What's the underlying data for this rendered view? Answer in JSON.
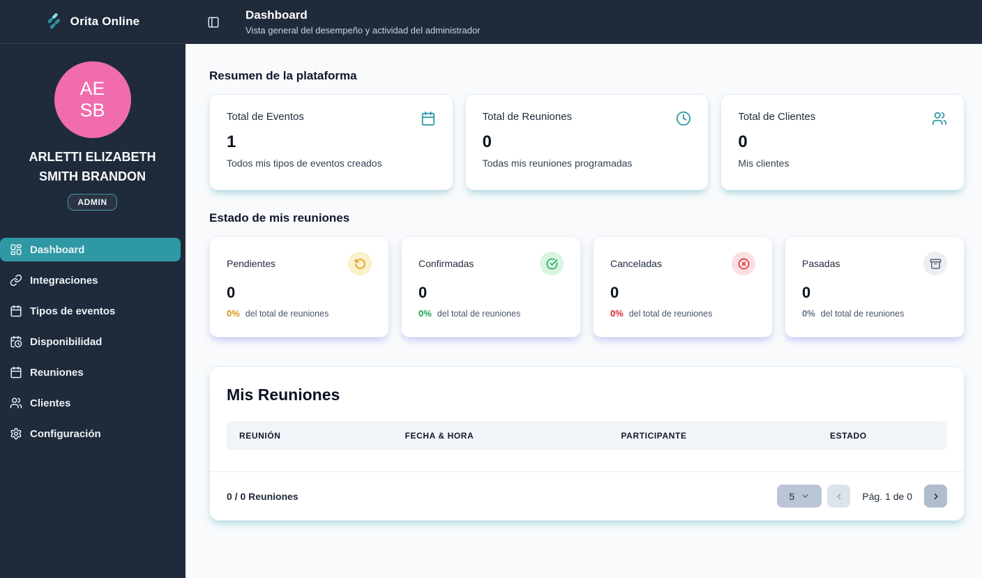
{
  "brand": {
    "name": "Orita Online"
  },
  "user": {
    "initials_line1": "AE",
    "initials_line2": "SB",
    "name_line1": "ARLETTI ELIZABETH",
    "name_line2": "SMITH BRANDON",
    "role": "ADMIN"
  },
  "sidebar": {
    "nav": [
      {
        "label": "Dashboard",
        "icon": "layout-dashboard-icon",
        "active": true
      },
      {
        "label": "Integraciones",
        "icon": "link-icon",
        "active": false
      },
      {
        "label": "Tipos de eventos",
        "icon": "calendar-icon",
        "active": false
      },
      {
        "label": "Disponibilidad",
        "icon": "calendar-clock-icon",
        "active": false
      },
      {
        "label": "Reuniones",
        "icon": "calendar-icon",
        "active": false
      },
      {
        "label": "Clientes",
        "icon": "users-icon",
        "active": false
      },
      {
        "label": "Configuración",
        "icon": "gear-icon",
        "active": false
      }
    ]
  },
  "header": {
    "title": "Dashboard",
    "subtitle": "Vista general del desempeño y actividad del administrador"
  },
  "summary": {
    "heading": "Resumen de la plataforma",
    "cards": [
      {
        "title": "Total de Eventos",
        "value": "1",
        "description": "Todos mis tipos de eventos creados",
        "icon": "calendar-icon"
      },
      {
        "title": "Total de Reuniones",
        "value": "0",
        "description": "Todas mis reuniones programadas",
        "icon": "clock-icon"
      },
      {
        "title": "Total de Clientes",
        "value": "0",
        "description": "Mis clientes",
        "icon": "users-icon"
      }
    ]
  },
  "status": {
    "heading": "Estado de mis reuniones",
    "suffix": "del total de reuniones",
    "cards": [
      {
        "title": "Pendientes",
        "value": "0",
        "percent": "0%",
        "icon": "rotate-ccw-icon",
        "accent": "#D9940E",
        "badge_bg": "#FAF0C9"
      },
      {
        "title": "Confirmadas",
        "value": "0",
        "percent": "0%",
        "icon": "circle-check-icon",
        "accent": "#16A34A",
        "badge_bg": "#D9F4E0"
      },
      {
        "title": "Canceladas",
        "value": "0",
        "percent": "0%",
        "icon": "circle-x-icon",
        "accent": "#E0232E",
        "badge_bg": "#FBDFE1"
      },
      {
        "title": "Pasadas",
        "value": "0",
        "percent": "0%",
        "icon": "archive-icon",
        "accent": "#64748B",
        "badge_bg": "#EBEEF2"
      }
    ]
  },
  "meetings": {
    "title": "Mis Reuniones",
    "columns": [
      "REUNIÓN",
      "FECHA & HORA",
      "PARTICIPANTE",
      "ESTADO"
    ],
    "rows": [],
    "footer": {
      "count": "0 / 0 Reuniones",
      "page_size": "5",
      "page_label": "Pág. 1 de 0"
    }
  },
  "colors": {
    "sidebar_bg": "#1F2A3A",
    "accent_teal": "#2E98A4",
    "avatar_pink": "#F06CAC",
    "pending_orange": "#D9940E",
    "confirmed_green": "#16A34A",
    "cancelled_red": "#E0232E",
    "past_gray": "#64748B"
  }
}
